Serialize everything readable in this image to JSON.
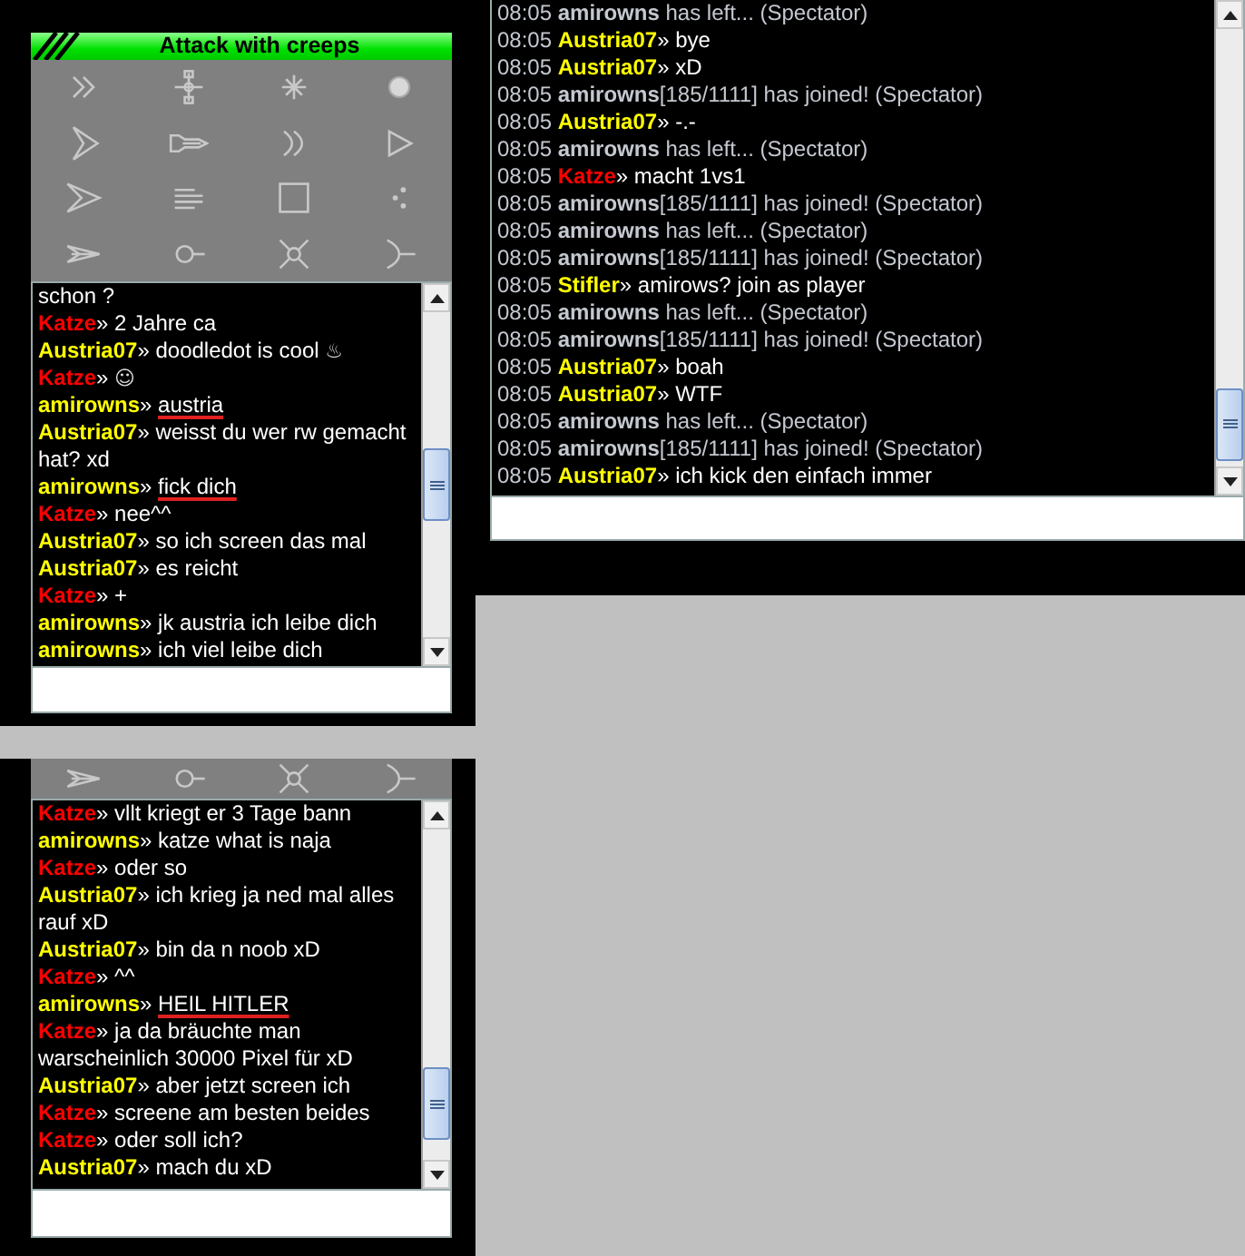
{
  "attack_panel": {
    "title": "Attack with creeps"
  },
  "chat_left": {
    "messages": [
      {
        "kind": "continuation",
        "text": "schon ?"
      },
      {
        "kind": "chat",
        "name": "Katze",
        "color": "#ff0000",
        "separator": "»",
        "text": "2 Jahre ca",
        "underlined": false
      },
      {
        "kind": "chat",
        "name": "Austria07",
        "color": "#ffff00",
        "separator": "»",
        "text": "doodledot is cool",
        "underlined": false,
        "emoticon": "♨"
      },
      {
        "kind": "chat",
        "name": "Katze",
        "color": "#ff0000",
        "separator": "»",
        "emoticon": "☺"
      },
      {
        "kind": "chat",
        "name": "amirowns",
        "color": "#ffff00",
        "separator": "»",
        "text": "austria",
        "underlined": true
      },
      {
        "kind": "chat",
        "name": "Austria07",
        "color": "#ffff00",
        "separator": "»",
        "text": "weisst du wer rw gemacht hat? xd",
        "underlined": false
      },
      {
        "kind": "chat",
        "name": "amirowns",
        "color": "#ffff00",
        "separator": "»",
        "text": "fick dich",
        "underlined": true
      },
      {
        "kind": "chat",
        "name": "Katze",
        "color": "#ff0000",
        "separator": "»",
        "text": "nee^^",
        "underlined": false
      },
      {
        "kind": "chat",
        "name": "Austria07",
        "color": "#ffff00",
        "separator": "»",
        "text": "so ich screen das mal",
        "underlined": false
      },
      {
        "kind": "chat",
        "name": "Austria07",
        "color": "#ffff00",
        "separator": "»",
        "text": "es reicht",
        "underlined": false
      },
      {
        "kind": "chat",
        "name": "Katze",
        "color": "#ff0000",
        "separator": "»",
        "text": "+",
        "underlined": false
      },
      {
        "kind": "chat",
        "name": "amirowns",
        "color": "#ffff00",
        "separator": "»",
        "text": "jk austria ich leibe dich",
        "underlined": false
      },
      {
        "kind": "chat",
        "name": "amirowns",
        "color": "#ffff00",
        "separator": "»",
        "text": "ich viel leibe dich",
        "underlined": false
      }
    ]
  },
  "chat_right": {
    "messages": [
      {
        "kind": "departure",
        "time": "08:05",
        "name": "amirowns",
        "text": "has left... (Spectator)"
      },
      {
        "kind": "chat",
        "time": "08:05",
        "name": "Austria07",
        "color": "#ffff00",
        "separator": "»",
        "text": "bye",
        "underlined": false
      },
      {
        "kind": "chat",
        "time": "08:05",
        "name": "Austria07",
        "color": "#ffff00",
        "separator": "»",
        "text": "xD",
        "underlined": false
      },
      {
        "kind": "arrival",
        "time": "08:05",
        "name": "amirowns",
        "text": "[185/1111] has joined! (Spectator)"
      },
      {
        "kind": "chat",
        "time": "08:05",
        "name": "Austria07",
        "color": "#ffff00",
        "separator": "»",
        "text": "-.-",
        "underlined": false
      },
      {
        "kind": "departure",
        "time": "08:05",
        "name": "amirowns",
        "text": "has left... (Spectator)"
      },
      {
        "kind": "chat",
        "time": "08:05",
        "name": "Katze",
        "color": "#ff0000",
        "separator": "»",
        "text": "macht 1vs1",
        "underlined": false
      },
      {
        "kind": "arrival",
        "time": "08:05",
        "name": "amirowns",
        "text": "[185/1111] has joined! (Spectator)"
      },
      {
        "kind": "departure",
        "time": "08:05",
        "name": "amirowns",
        "text": "has left... (Spectator)"
      },
      {
        "kind": "arrival",
        "time": "08:05",
        "name": "amirowns",
        "text": "[185/1111] has joined! (Spectator)"
      },
      {
        "kind": "chat",
        "time": "08:05",
        "name": "Stifler",
        "color": "#ffff00",
        "separator": "»",
        "text": "amirows? join as player",
        "underlined": false
      },
      {
        "kind": "departure",
        "time": "08:05",
        "name": "amirowns",
        "text": "has left... (Spectator)"
      },
      {
        "kind": "arrival",
        "time": "08:05",
        "name": "amirowns",
        "text": "[185/1111] has joined! (Spectator)"
      },
      {
        "kind": "chat",
        "time": "08:05",
        "name": "Austria07",
        "color": "#ffff00",
        "separator": "»",
        "text": "boah",
        "underlined": false
      },
      {
        "kind": "chat",
        "time": "08:05",
        "name": "Austria07",
        "color": "#ffff00",
        "separator": "»",
        "text": "WTF",
        "underlined": false
      },
      {
        "kind": "departure",
        "time": "08:05",
        "name": "amirowns",
        "text": "has left... (Spectator)"
      },
      {
        "kind": "arrival",
        "time": "08:05",
        "name": "amirowns",
        "text": "[185/1111] has joined! (Spectator)"
      },
      {
        "kind": "chat",
        "time": "08:05",
        "name": "Austria07",
        "color": "#ffff00",
        "separator": "»",
        "text": "ich kick den einfach immer",
        "underlined": false
      }
    ]
  },
  "chat_bottom": {
    "messages": [
      {
        "kind": "chat",
        "name": "Katze",
        "color": "#ff0000",
        "separator": "»",
        "text": "vllt kriegt er 3 Tage bann",
        "underlined": false
      },
      {
        "kind": "chat",
        "name": "amirowns",
        "color": "#ffff00",
        "separator": "»",
        "text": "katze what is naja",
        "underlined": false
      },
      {
        "kind": "chat",
        "name": "Katze",
        "color": "#ff0000",
        "separator": "»",
        "text": "oder so",
        "underlined": false
      },
      {
        "kind": "chat",
        "name": "Austria07",
        "color": "#ffff00",
        "separator": "»",
        "text": "ich krieg ja ned mal alles rauf xD",
        "underlined": false
      },
      {
        "kind": "chat",
        "name": "Austria07",
        "color": "#ffff00",
        "separator": "»",
        "text": "bin da n noob xD",
        "underlined": false
      },
      {
        "kind": "chat",
        "name": "Katze",
        "color": "#ff0000",
        "separator": "»",
        "text": "^^",
        "underlined": false
      },
      {
        "kind": "chat",
        "name": "amirowns",
        "color": "#ffff00",
        "separator": "»",
        "text": "HEIL HITLER",
        "underlined": true
      },
      {
        "kind": "chat",
        "name": "Katze",
        "color": "#ff0000",
        "separator": "»",
        "text": "ja da bräuchte man warscheinlich 30000 Pixel für xD",
        "underlined": false
      },
      {
        "kind": "chat",
        "name": "Austria07",
        "color": "#ffff00",
        "separator": "»",
        "text": "aber jetzt screen ich",
        "underlined": false
      },
      {
        "kind": "chat",
        "name": "Katze",
        "color": "#ff0000",
        "separator": "»",
        "text": "screene am besten beides",
        "underlined": false
      },
      {
        "kind": "chat",
        "name": "Katze",
        "color": "#ff0000",
        "separator": "»",
        "text": "oder soll ich?",
        "underlined": false
      },
      {
        "kind": "chat",
        "name": "Austria07",
        "color": "#ffff00",
        "separator": "»",
        "text": "mach du xD",
        "underlined": false
      }
    ]
  }
}
